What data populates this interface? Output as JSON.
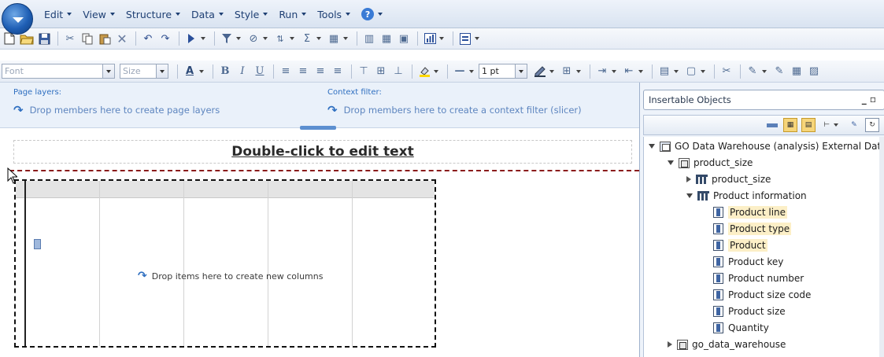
{
  "menubar": {
    "items": [
      {
        "label": "Edit"
      },
      {
        "label": "View"
      },
      {
        "label": "Structure"
      },
      {
        "label": "Data"
      },
      {
        "label": "Style"
      },
      {
        "label": "Run"
      },
      {
        "label": "Tools"
      }
    ],
    "help_glyph": "?"
  },
  "toolbar1": {
    "icons": [
      "new-icon",
      "open-icon",
      "save-icon",
      "cut-icon",
      "copy-icon",
      "paste-icon",
      "delete-icon",
      "undo-icon",
      "redo-icon",
      "run-icon",
      "filter-icon",
      "suppress-icon",
      "sort-icon",
      "summarize-icon",
      "insert-chart-icon",
      "layout-icon",
      "grid-icon",
      "crosstab-icon",
      "bar-chart-icon",
      "text-object-icon"
    ]
  },
  "toolbar2": {
    "font_placeholder": "Font",
    "size_placeholder": "Size",
    "line_weight": "1 pt",
    "icons": [
      "font-color-icon",
      "bold-icon",
      "italic-icon",
      "underline-icon",
      "align-left-icon",
      "align-center-icon",
      "align-right-icon",
      "justify-icon",
      "valign-top-icon",
      "valign-middle-icon",
      "valign-bottom-icon",
      "background-color-icon",
      "border-line-icon",
      "border-color-icon",
      "borders-icon",
      "indent-icon",
      "outdent-icon",
      "data-format-icon",
      "style-icon",
      "break-icon",
      "conditional-style-icon",
      "class-icon",
      "properties-icon"
    ]
  },
  "dropzones": {
    "page_layers_label": "Page layers:",
    "page_layers_text": "Drop members here to create page layers",
    "context_filter_label": "Context filter:",
    "context_filter_text": "Drop members here to create a context filter (slicer)"
  },
  "canvas": {
    "title": "Double-click to edit text",
    "drop_columns_text": "Drop items here to create new columns"
  },
  "insertable_objects": {
    "title": "Insertable Objects",
    "tree": [
      {
        "label": "GO Data Warehouse (analysis) External Data",
        "level": 0,
        "expanded": true,
        "icon": "package-icon"
      },
      {
        "label": "product_size",
        "level": 1,
        "expanded": true,
        "icon": "namespace-icon"
      },
      {
        "label": "product_size",
        "level": 2,
        "expanded": false,
        "icon": "query-subject-icon"
      },
      {
        "label": "Product information",
        "level": 2,
        "expanded": true,
        "icon": "query-subject-icon"
      },
      {
        "label": "Product line",
        "level": 3,
        "highlight": true,
        "icon": "data-item-icon"
      },
      {
        "label": "Product type",
        "level": 3,
        "highlight": true,
        "icon": "data-item-icon"
      },
      {
        "label": "Product",
        "level": 3,
        "highlight": true,
        "icon": "data-item-icon"
      },
      {
        "label": "Product key",
        "level": 3,
        "highlight": false,
        "icon": "data-item-icon"
      },
      {
        "label": "Product number",
        "level": 3,
        "highlight": false,
        "icon": "data-item-icon"
      },
      {
        "label": "Product size code",
        "level": 3,
        "highlight": false,
        "icon": "data-item-icon"
      },
      {
        "label": "Product size",
        "level": 3,
        "highlight": false,
        "icon": "data-item-icon"
      },
      {
        "label": "Quantity",
        "level": 3,
        "highlight": false,
        "icon": "data-item-icon"
      },
      {
        "label": "go_data_warehouse",
        "level": 1,
        "expanded": false,
        "icon": "namespace-icon"
      }
    ]
  },
  "colors": {
    "accent": "#2f6fc0",
    "highlight": "#fcefc7",
    "page_break": "#8b1c1c"
  }
}
